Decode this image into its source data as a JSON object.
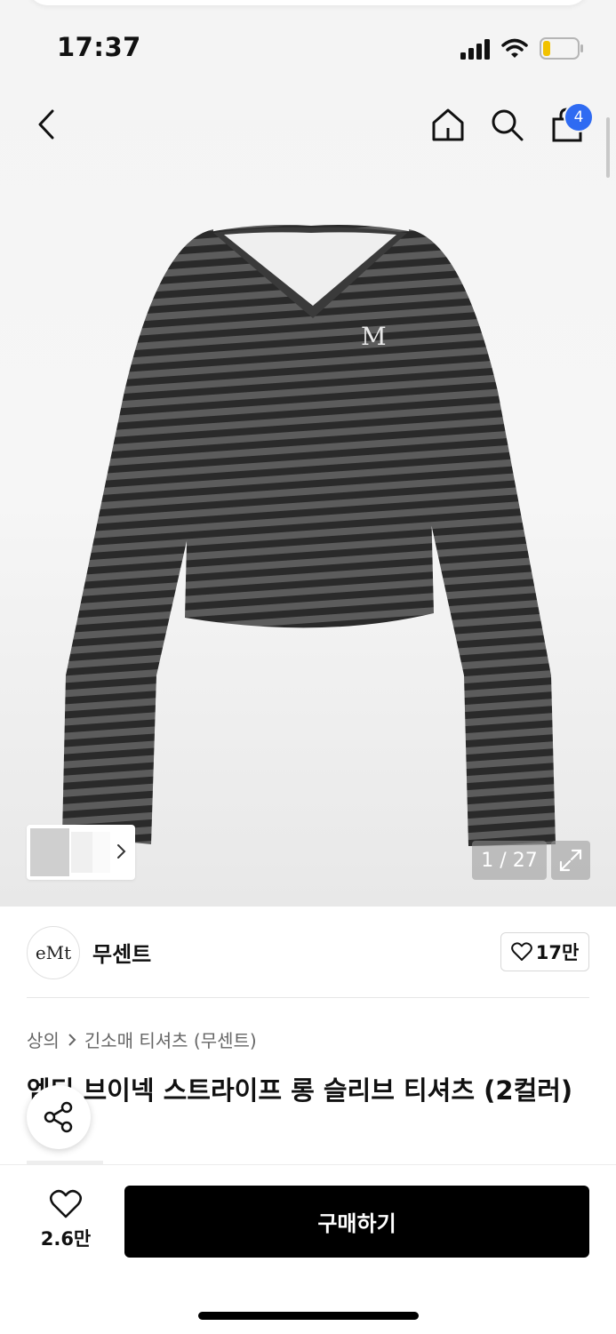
{
  "status_bar": {
    "time": "17:37"
  },
  "header": {
    "cart_count": "4"
  },
  "gallery": {
    "counter": "1 / 27"
  },
  "brand": {
    "logo_text": "eMt",
    "name": "무센트",
    "likes": "17만"
  },
  "breadcrumb": {
    "category": "상의",
    "subcategory": "긴소매 티셔츠 (무센트)"
  },
  "product": {
    "title": "엠티 브이넥 스트라이프 롱 슬리브 티셔츠 (2컬러)"
  },
  "bottom": {
    "wish_count": "2.6만",
    "buy_label": "구매하기"
  },
  "colors": {
    "accent": "#2f6bf2",
    "buy_button": "#000000"
  }
}
